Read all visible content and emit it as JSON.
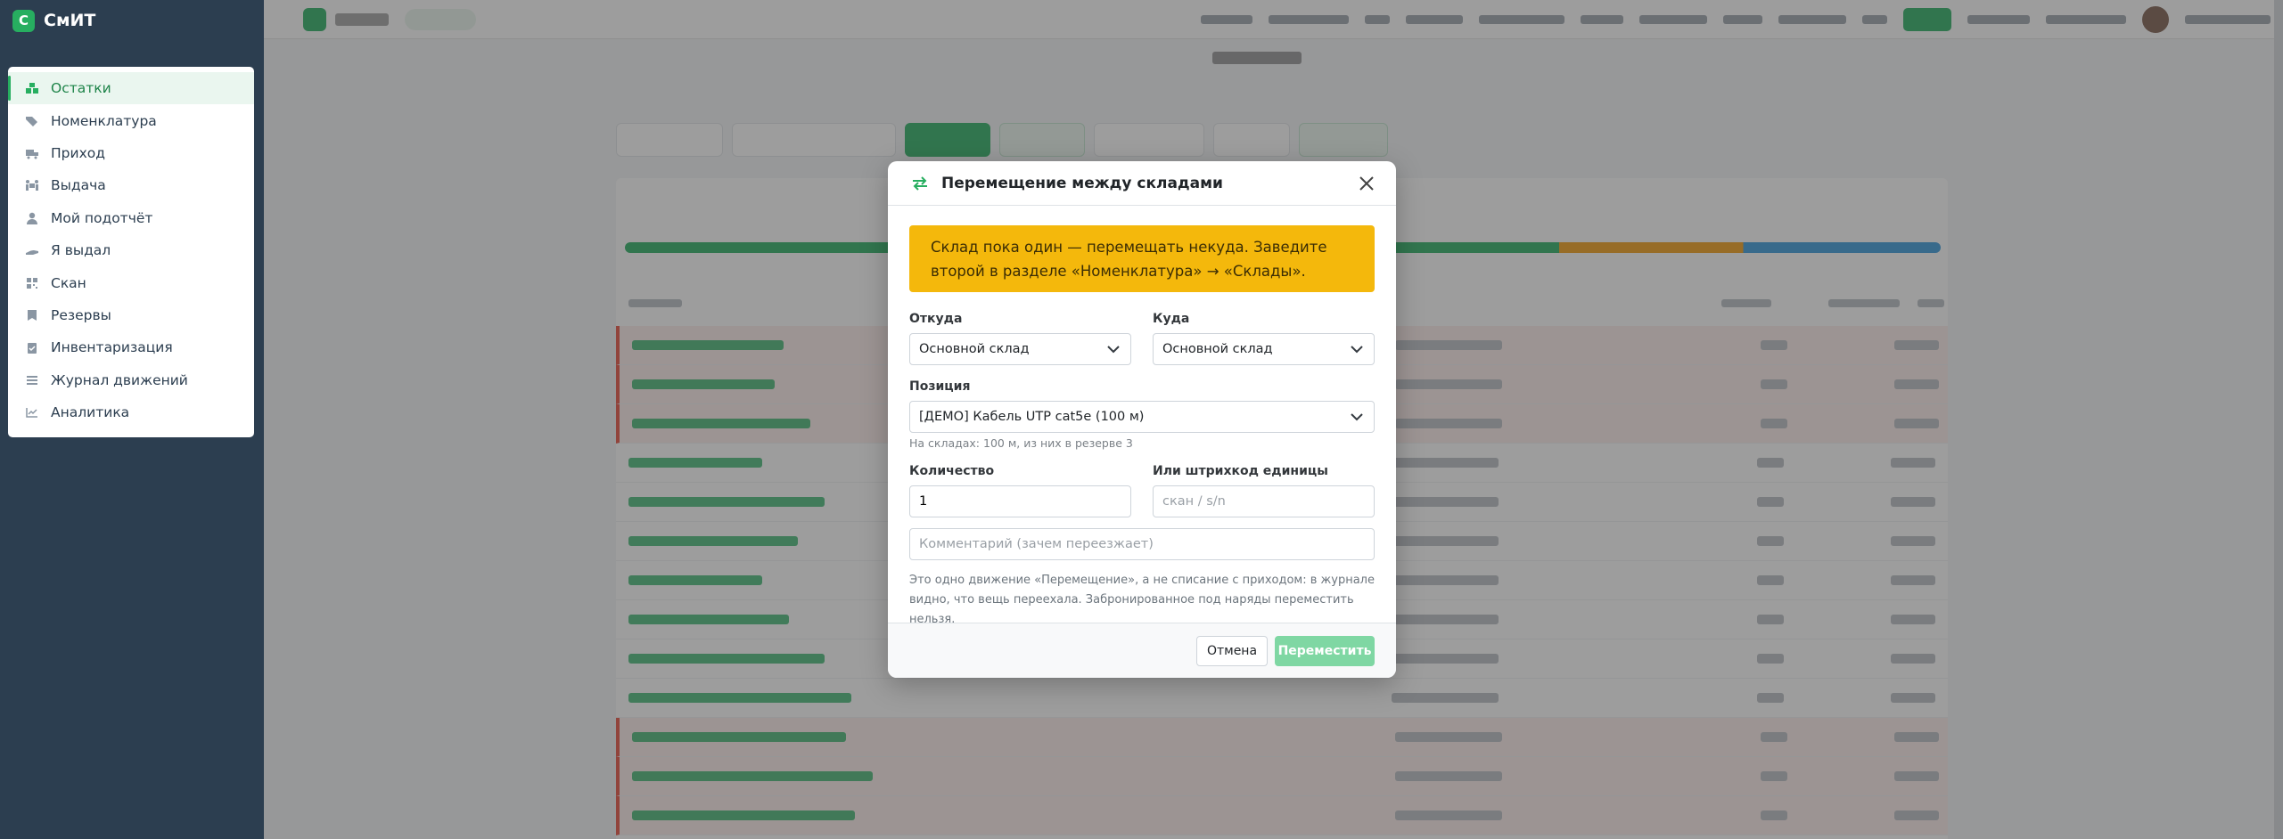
{
  "brand": {
    "logo_letter": "С",
    "name": "СмИТ"
  },
  "sidebar": {
    "items": [
      {
        "label": "Остатки",
        "icon": "boxes-icon",
        "active": true
      },
      {
        "label": "Номенклатура",
        "icon": "tags-icon"
      },
      {
        "label": "Приход",
        "icon": "truck-icon"
      },
      {
        "label": "Выдача",
        "icon": "people-carry-icon"
      },
      {
        "label": "Мой подотчёт",
        "icon": "user-tie-icon"
      },
      {
        "label": "Я выдал",
        "icon": "hand-holding-icon"
      },
      {
        "label": "Скан",
        "icon": "qrcode-icon"
      },
      {
        "label": "Резервы",
        "icon": "bookmark-icon"
      },
      {
        "label": "Инвентаризация",
        "icon": "clipboard-check-icon"
      },
      {
        "label": "Журнал движений",
        "icon": "list-icon"
      },
      {
        "label": "Аналитика",
        "icon": "chart-line-icon"
      }
    ]
  },
  "modal": {
    "title": "Перемещение между складами",
    "alert": "Склад пока один — перемещать некуда. Заведите второй в разделе «Номенклатура» → «Склады».",
    "from": {
      "label": "Откуда",
      "value": "Основной склад"
    },
    "to": {
      "label": "Куда",
      "value": "Основной склад"
    },
    "position": {
      "label": "Позиция",
      "value": "[ДЕМО] Кабель UTP cat5e (100 м)",
      "hint": "На складах: 100 м, из них в резерве 3"
    },
    "quantity": {
      "label": "Количество",
      "value": "1"
    },
    "barcode": {
      "label": "Или штрихкод единицы",
      "placeholder": "скан / s/n"
    },
    "comment": {
      "placeholder": "Комментарий (зачем переезжает)"
    },
    "note": "Это одно движение «Перемещение», а не списание с приходом: в журнале видно, что вещь переехала. Забронированное под наряды переместить нельзя.",
    "cancel_label": "Отмена",
    "submit_label": "Переместить"
  },
  "colors": {
    "accent": "#27ae60",
    "sidebar_bg": "#2c3e50",
    "alert_bg": "#f4b80c",
    "submit_disabled": "#7fd7a3"
  }
}
